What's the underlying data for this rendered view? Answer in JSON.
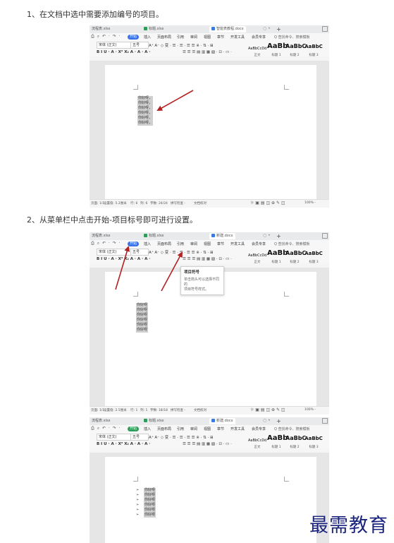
{
  "steps": [
    {
      "text": "1、在文档中选中需要添加编号的项目。"
    },
    {
      "text": "2、从菜单栏中点击开始-项目标号即可进行设置。"
    }
  ],
  "shots": [
    {
      "tabs": [
        "流程表.xlsx",
        "标题.xlsx",
        "智能表教程.docx"
      ],
      "menus": [
        "开始",
        "插入",
        "页面布局",
        "引用",
        "审阅",
        "视图",
        "章节",
        "开发工具",
        "会员专享"
      ],
      "search": "Q 查找命令、搜索模板",
      "font_name": "宋体 (正文)",
      "font_size": "五号",
      "styles": [
        {
          "sample": "AaBbCcDd",
          "label": "正文"
        },
        {
          "sample": "AaBb",
          "label": "标题 1"
        },
        {
          "sample": "AaBbC",
          "label": "标题 2"
        },
        {
          "sample": "AaBbC",
          "label": "标题 3"
        }
      ],
      "lines": [
        "你好呀，",
        "你好呀，",
        "你好呀，",
        "你好呀，",
        "你好呀，",
        "你好呀，"
      ],
      "status": {
        "page": "页面: 1/1",
        "section": "设置值: 5.2厘米",
        "line": "行: 6",
        "col": "列: 6",
        "words": "字数: 24/24",
        "spell": "拼写检查 -",
        "doc": "文档校对",
        "zoom": "100% -"
      }
    },
    {
      "tabs": [
        "流程表.xlsx",
        "标题.xlsx",
        "新建.docx"
      ],
      "menus": [
        "开始",
        "插入",
        "页面布局",
        "引用",
        "审阅",
        "视图",
        "章节",
        "开发工具",
        "会员专享"
      ],
      "search": "Q 查找命令、搜索模板",
      "font_name": "宋体 (正文)",
      "font_size": "五号",
      "styles": [
        {
          "sample": "AaBbCcDd",
          "label": "正文"
        },
        {
          "sample": "AaBb",
          "label": "标题 1"
        },
        {
          "sample": "AaBbC",
          "label": "标题 2"
        },
        {
          "sample": "AaBbC",
          "label": "标题 3"
        }
      ],
      "tooltip": {
        "title": "项目符号",
        "desc1": "单击箭头可以选择不同的",
        "desc2": "项目符号样式。"
      },
      "lines": [
        "你好呀",
        "你好呀",
        "你好呀",
        "你好呀",
        "你好呀",
        "你好呀"
      ],
      "status": {
        "page": "页面: 1/1",
        "section": "设置值: 2.5厘米",
        "line": "行: 1",
        "col": "列: 1",
        "words": "字数: 18/18",
        "spell": "拼写检查 -",
        "doc": "文档校对",
        "zoom": "100% -"
      }
    },
    {
      "tabs": [
        "流程表.xlsx",
        "标题.xlsx",
        "新建.docx"
      ],
      "menus": [
        "开始",
        "插入",
        "页面布局",
        "引用",
        "审阅",
        "视图",
        "章节",
        "开发工具",
        "会员专享"
      ],
      "search": "Q 查找命令、搜索模板",
      "font_name": "宋体 (正文)",
      "font_size": "五号",
      "styles": [
        {
          "sample": "AaBbCcDd",
          "label": "正文"
        },
        {
          "sample": "AaBb",
          "label": "标题 1"
        },
        {
          "sample": "AaBbC",
          "label": "标题 2"
        },
        {
          "sample": "AaBbC",
          "label": "标题 3"
        }
      ],
      "bullet": "➢",
      "lines": [
        "你好呀",
        "你好呀",
        "你好呀",
        "你好呀",
        "你好呀",
        "你好呀"
      ]
    }
  ],
  "toolbar_row1": "A⁺ A⁻ ◇ 变 · ☰ · ☰ · ☰ ☰ ※ · ⇅ · ⊞",
  "toolbar_row2": "B I U · A · X² X₂ A · A · A ·",
  "watermark": "最需教育",
  "colors": {
    "accent": "#3a73e8",
    "arrow": "#b22222",
    "watermark": "#1a237e",
    "selection": "#d0d0d0"
  }
}
